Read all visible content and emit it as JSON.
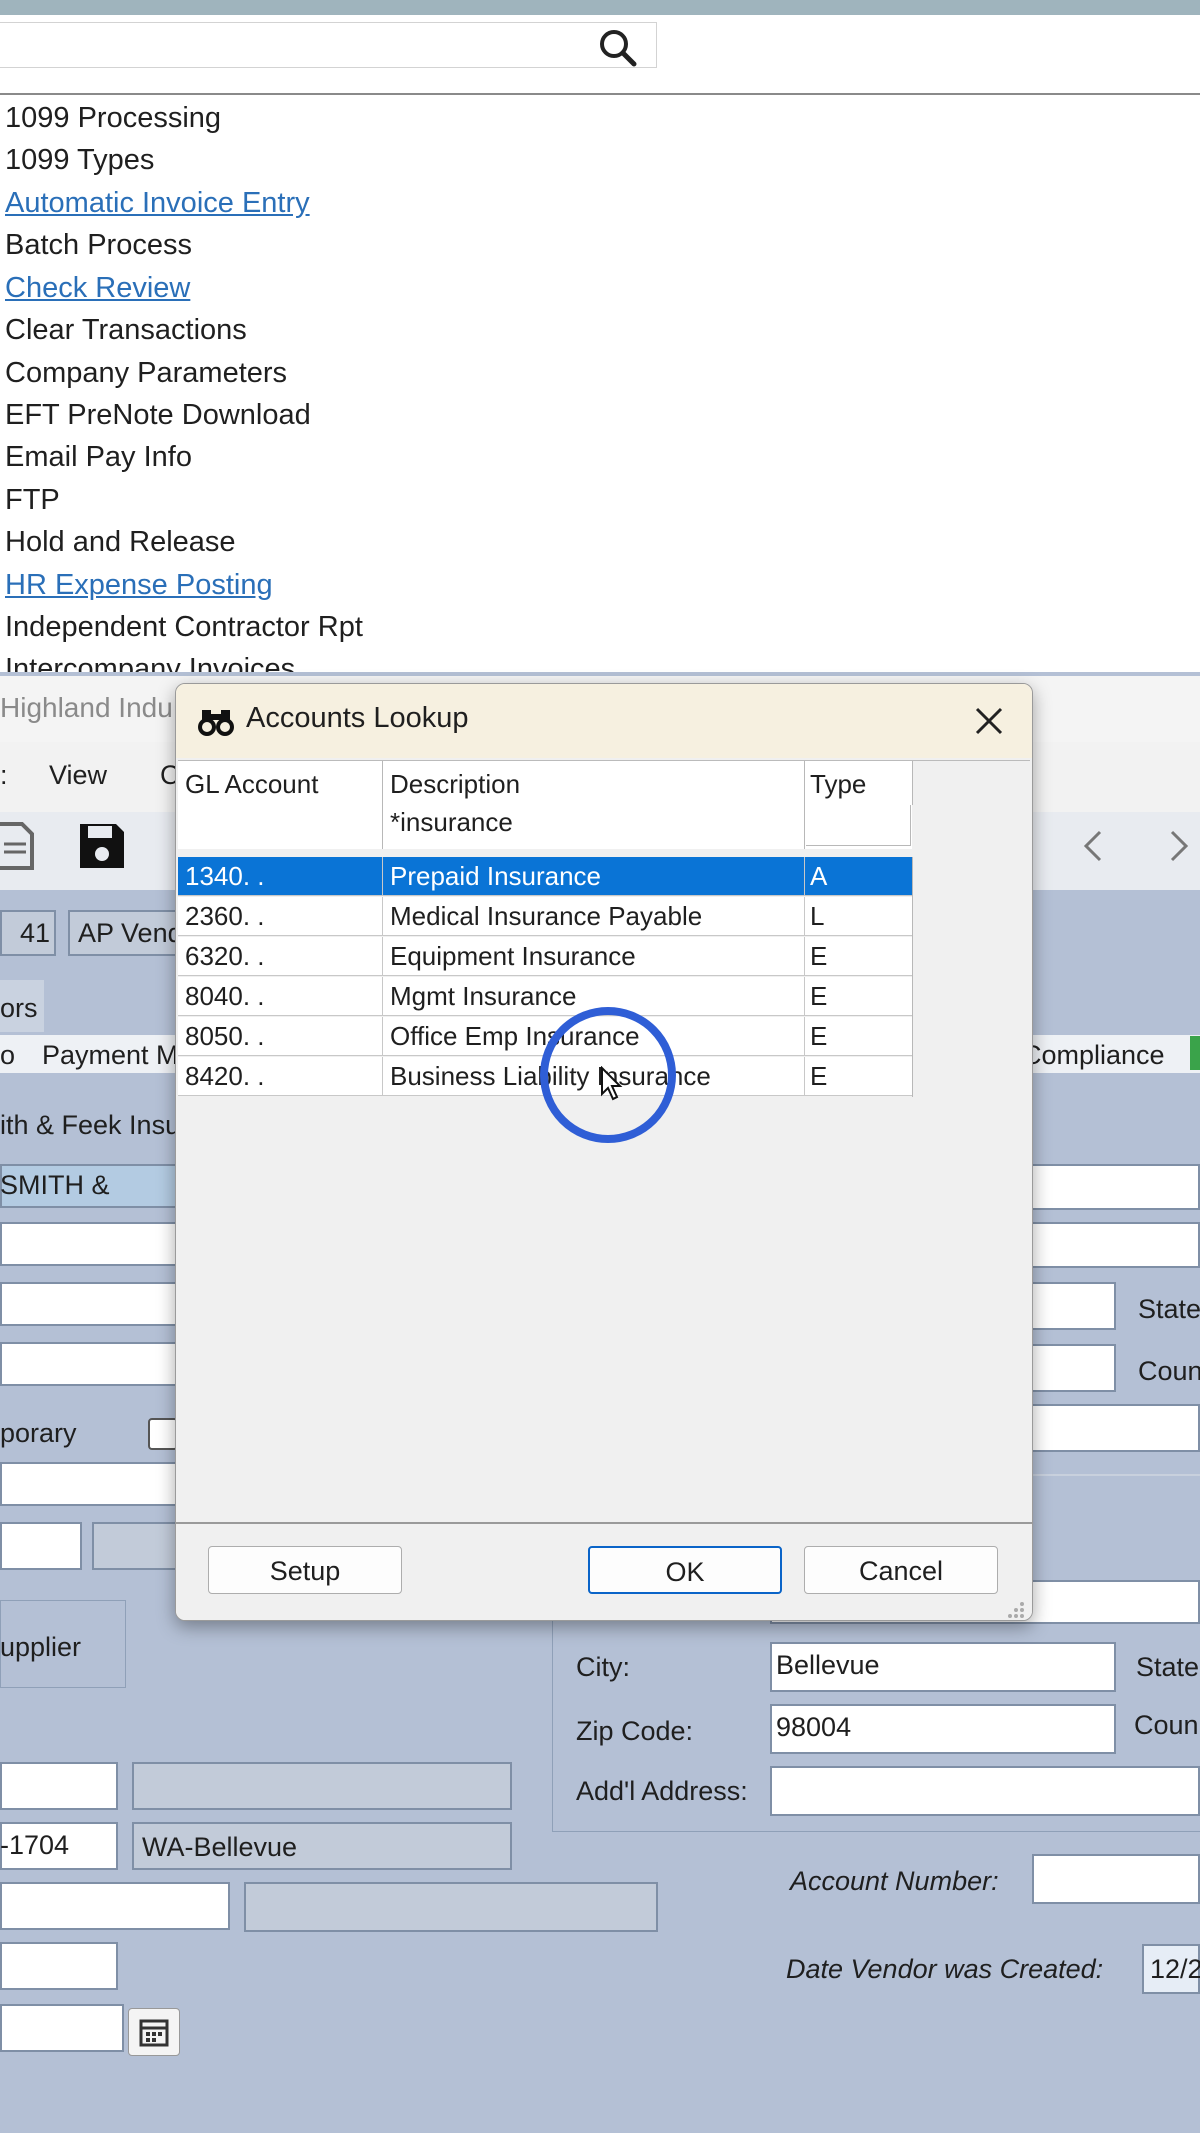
{
  "nav": {
    "search_placeholder": "",
    "items": [
      {
        "label": "1099 Processing",
        "link": false
      },
      {
        "label": "1099 Types",
        "link": false
      },
      {
        "label": "Automatic Invoice Entry",
        "link": true
      },
      {
        "label": "Batch Process",
        "link": false
      },
      {
        "label": "Check Review",
        "link": true
      },
      {
        "label": "Clear Transactions",
        "link": false
      },
      {
        "label": "Company Parameters",
        "link": false
      },
      {
        "label": "EFT PreNote Download",
        "link": false
      },
      {
        "label": "Email Pay Info",
        "link": false
      },
      {
        "label": "FTP",
        "link": false
      },
      {
        "label": "Hold and Release",
        "link": false
      },
      {
        "label": "HR Expense Posting",
        "link": true
      },
      {
        "label": "Independent Contractor Rpt",
        "link": false
      },
      {
        "label": "Intercompany Invoices",
        "link": false
      }
    ]
  },
  "background": {
    "window_title": "Highland Indu",
    "menu_view": "View",
    "menu_c": "C",
    "vendor_num": "41",
    "vendor_field": "AP Vend",
    "tab_ors": "ors",
    "tab_o": "o",
    "tab_payment": "Payment M",
    "tab_compliance": "Compliance",
    "name_text": "ith & Feek Insu",
    "sort_text": "SMITH &",
    "temporary_label": "porary",
    "supplier_label": "upplier",
    "city_label": "City:",
    "city_value": "Bellevue",
    "zip_label": "Zip Code:",
    "zip_value": "98004",
    "addl_label": "Add'l Address:",
    "state_label": "State",
    "country_label": "Coun",
    "phone_value": "-1704",
    "location_value": "WA-Bellevue",
    "account_number_label": "Account Number:",
    "date_created_label": "Date Vendor was Created:",
    "date_created_value": "12/2"
  },
  "dialog": {
    "title": "Accounts Lookup",
    "columns": {
      "gl": "GL Account",
      "desc": "Description",
      "type": "Type"
    },
    "filter": {
      "gl": "",
      "desc": "*insurance",
      "type": ""
    },
    "rows": [
      {
        "gl": "1340.  .",
        "desc": "Prepaid Insurance",
        "type": "A",
        "selected": true
      },
      {
        "gl": "2360.  .",
        "desc": "Medical Insurance Payable",
        "type": "L",
        "selected": false
      },
      {
        "gl": "6320.  .",
        "desc": "Equipment Insurance",
        "type": "E",
        "selected": false
      },
      {
        "gl": "8040.  .",
        "desc": "Mgmt Insurance",
        "type": "E",
        "selected": false
      },
      {
        "gl": "8050.  .",
        "desc": "Office Emp Insurance",
        "type": "E",
        "selected": false
      },
      {
        "gl": "8420.  .",
        "desc": "Business Liability Insurance",
        "type": "E",
        "selected": false
      }
    ],
    "buttons": {
      "setup": "Setup",
      "ok": "OK",
      "cancel": "Cancel"
    }
  }
}
